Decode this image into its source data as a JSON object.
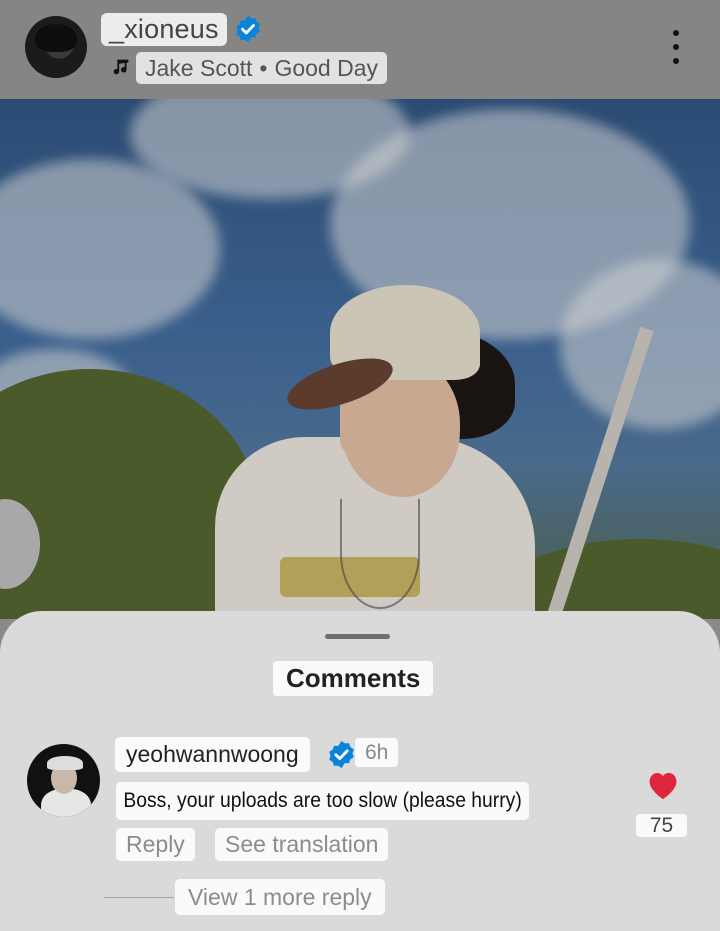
{
  "post": {
    "username": "_xioneus",
    "verified": true,
    "song": {
      "artist": "Jake Scott",
      "separator": "•",
      "title": "Good Day"
    }
  },
  "comments_sheet": {
    "title": "Comments",
    "comments": [
      {
        "username": "yeohwannwoong",
        "verified": true,
        "time": "6h",
        "text": "Boss, your uploads are too slow (please hurry)",
        "reply_label": "Reply",
        "translate_label": "See translation",
        "likes": "75",
        "liked": true,
        "more_replies_label": "View 1 more reply"
      }
    ]
  },
  "colors": {
    "verified_blue": "#0095f6",
    "like_red": "#e0263d"
  },
  "icons": [
    "music-note-icon",
    "verified-badge-icon",
    "more-vertical-icon",
    "heart-filled-icon"
  ]
}
